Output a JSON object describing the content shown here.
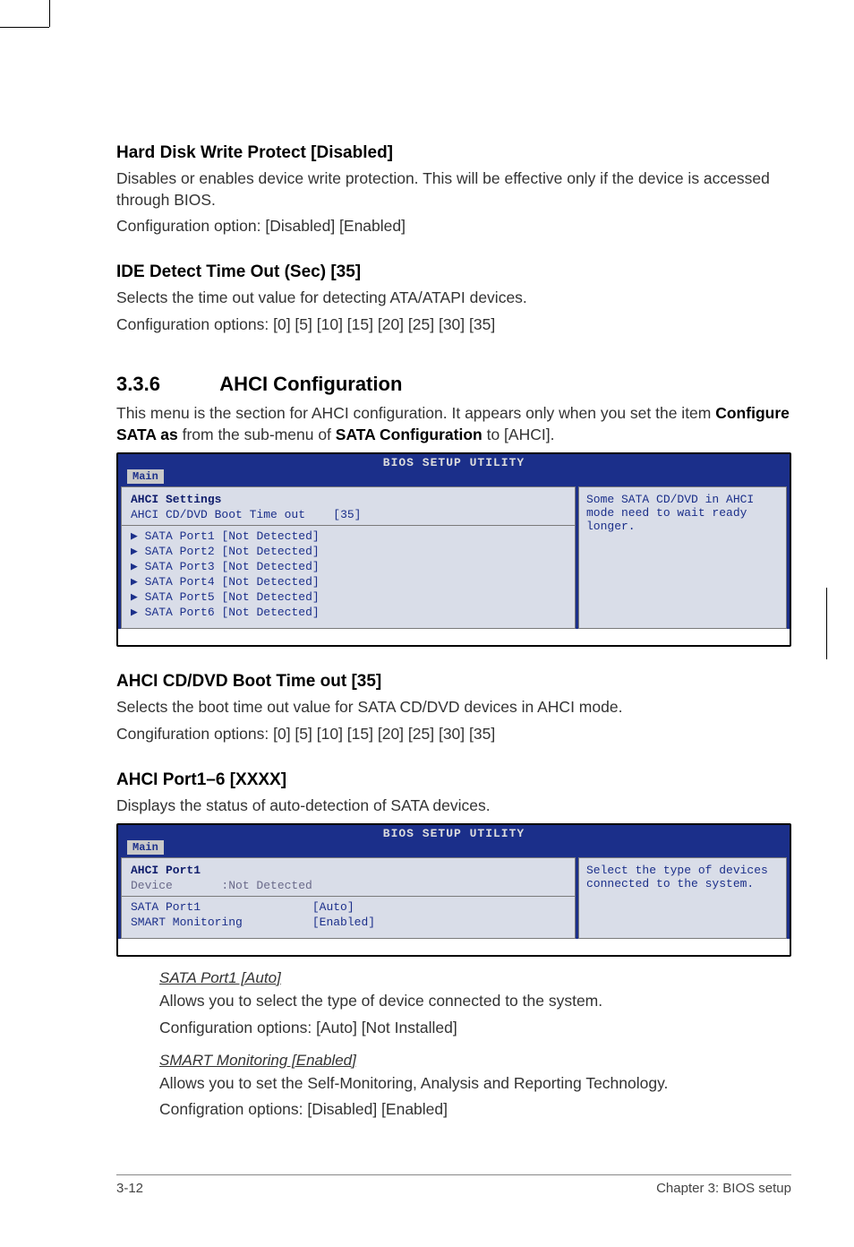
{
  "headings": {
    "h1": "Hard Disk Write Protect [Disabled]",
    "h2": "IDE Detect Time Out (Sec) [35]",
    "section_num": "3.3.6",
    "section_title": "AHCI Configuration",
    "h3": "AHCI CD/DVD Boot Time out [35]",
    "h4": "AHCI Port1–6 [XXXX]"
  },
  "paragraphs": {
    "p1a": "Disables or enables device write protection. This will be effective only if the device is accessed through BIOS.",
    "p1b": "Configuration option: [Disabled] [Enabled]",
    "p2a": "Selects the time out value for detecting ATA/ATAPI devices.",
    "p2b": "Configuration options: [0] [5] [10] [15] [20] [25] [30] [35]",
    "p3a": "This menu is the section for AHCI configuration. It appears only when you set the item ",
    "p3b": "Configure SATA as",
    "p3c": " from the sub-menu of ",
    "p3d": "SATA Configuration",
    "p3e": " to [AHCI].",
    "p4a": "Selects the boot time out value for SATA CD/DVD devices in AHCI mode.",
    "p4b": "Congifuration options: [0] [5] [10] [15] [20] [25] [30] [35]",
    "p5": "Displays the status of auto-detection of SATA devices."
  },
  "bios1": {
    "title": "BIOS SETUP UTILITY",
    "tab": "Main",
    "heading": "AHCI Settings",
    "row1_label": "AHCI CD/DVD Boot Time out",
    "row1_val": "[35]",
    "ports": [
      "SATA Port1 [Not Detected]",
      "SATA Port2 [Not Detected]",
      "SATA Port3 [Not Detected]",
      "SATA Port4 [Not Detected]",
      "SATA Port5 [Not Detected]",
      "SATA Port6 [Not Detected]"
    ],
    "help": "Some SATA CD/DVD in AHCI mode need to wait ready longer."
  },
  "bios2": {
    "title": "BIOS SETUP UTILITY",
    "tab": "Main",
    "heading": "AHCI Port1",
    "dev_label": "Device",
    "dev_val": ":Not Detected",
    "row1_label": "SATA Port1",
    "row1_val": "[Auto]",
    "row2_label": "SMART Monitoring",
    "row2_val": "[Enabled]",
    "help": "Select the type of devices connected to the system."
  },
  "sub": {
    "s1_title": "SATA Port1 [Auto]",
    "s1_p1": "Allows you to select the type of device connected to the system.",
    "s1_p2": "Configuration options: [Auto] [Not Installed]",
    "s2_title": "SMART Monitoring [Enabled]",
    "s2_p1": "Allows you to set the Self-Monitoring, Analysis and Reporting Technology.",
    "s2_p2": "Configration options: [Disabled] [Enabled]"
  },
  "footer": {
    "left": "3-12",
    "right": "Chapter 3: BIOS setup"
  }
}
